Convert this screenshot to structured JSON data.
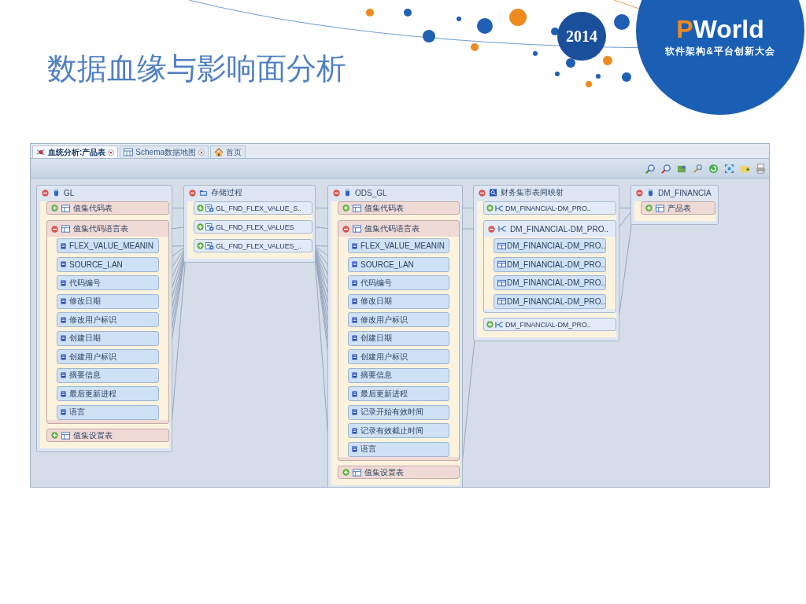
{
  "slide": {
    "title": "数据血缘与影响面分析",
    "logo": {
      "year": "2014",
      "brand": "PWorld",
      "tagline": "软件架构&平台创新大会"
    }
  },
  "tabs": [
    {
      "label": "血统分析:产品表",
      "kind": "lineage",
      "selected": true,
      "closable": true
    },
    {
      "label": "Schema数据地图",
      "kind": "map",
      "selected": false,
      "closable": true
    },
    {
      "label": "首页",
      "kind": "home",
      "selected": false,
      "closable": false
    }
  ],
  "diagram": {
    "nodes": [
      {
        "title": "GL",
        "kind": "database",
        "expanded": true,
        "items": [
          {
            "label": "值集代码表",
            "kind": "table",
            "expanded": false
          },
          {
            "label": "值集代码语言表",
            "kind": "table",
            "expanded": true,
            "children": [
              {
                "label": "FLEX_VALUE_MEANIN",
                "kind": "column"
              },
              {
                "label": "SOURCE_LAN",
                "kind": "column"
              },
              {
                "label": "代码编号",
                "kind": "column"
              },
              {
                "label": "修改日期",
                "kind": "column"
              },
              {
                "label": "修改用户标识",
                "kind": "column"
              },
              {
                "label": "创建日期",
                "kind": "column"
              },
              {
                "label": "创建用户标识",
                "kind": "column"
              },
              {
                "label": "摘要信息",
                "kind": "column"
              },
              {
                "label": "最后更新进程",
                "kind": "column"
              },
              {
                "label": "语言",
                "kind": "column"
              }
            ]
          },
          {
            "label": "值集设置表",
            "kind": "table",
            "expanded": false
          }
        ]
      },
      {
        "title": "存储过程",
        "kind": "folder",
        "expanded": true,
        "items": [
          {
            "label": "GL_FND_FLEX_VALUE_S..",
            "kind": "procedure",
            "expanded": false
          },
          {
            "label": "GL_FND_FLEX_VALUES",
            "kind": "procedure",
            "expanded": false
          },
          {
            "label": "GL_FND_FLEX_VALUES_..",
            "kind": "procedure",
            "expanded": false
          }
        ]
      },
      {
        "title": "ODS_GL",
        "kind": "database",
        "expanded": true,
        "items": [
          {
            "label": "值集代码表",
            "kind": "table",
            "expanded": false
          },
          {
            "label": "值集代码语言表",
            "kind": "table",
            "expanded": true,
            "children": [
              {
                "label": "FLEX_VALUE_MEANIN",
                "kind": "column"
              },
              {
                "label": "SOURCE_LAN",
                "kind": "column"
              },
              {
                "label": "代码编号",
                "kind": "column"
              },
              {
                "label": "修改日期",
                "kind": "column"
              },
              {
                "label": "修改用户标识",
                "kind": "column"
              },
              {
                "label": "创建日期",
                "kind": "column"
              },
              {
                "label": "创建用户标识",
                "kind": "column"
              },
              {
                "label": "摘要信息",
                "kind": "column"
              },
              {
                "label": "最后更新进程",
                "kind": "column"
              },
              {
                "label": "记录开始有效时间",
                "kind": "column"
              },
              {
                "label": "记录有效截止时间",
                "kind": "column"
              },
              {
                "label": "语言",
                "kind": "column"
              }
            ]
          },
          {
            "label": "值集设置表",
            "kind": "table",
            "expanded": false
          }
        ]
      },
      {
        "title": "财务集市表间映射",
        "kind": "mapping-set",
        "expanded": true,
        "items": [
          {
            "label": "DM_FINANCIAL-DM_PRO..",
            "kind": "mapping",
            "expanded": false
          },
          {
            "label": "DM_FINANCIAL-DM_PRO..",
            "kind": "mapping",
            "expanded": true,
            "children": [
              {
                "label": "DM_FINANCIAL-DM_PRO..",
                "kind": "mapping-table"
              },
              {
                "label": "DM_FINANCIAL-DM_PRO..",
                "kind": "mapping-table"
              },
              {
                "label": "DM_FINANCIAL-DM_PRO..",
                "kind": "mapping-table"
              },
              {
                "label": "DM_FINANCIAL-DM_PRO..",
                "kind": "mapping-table"
              }
            ]
          },
          {
            "label": "DM_FINANCIAL-DM_PRO..",
            "kind": "mapping",
            "expanded": false
          }
        ]
      },
      {
        "title": "DM_FINANCIA",
        "kind": "database",
        "expanded": true,
        "items": [
          {
            "label": "产品表",
            "kind": "table",
            "expanded": false
          }
        ]
      }
    ]
  }
}
